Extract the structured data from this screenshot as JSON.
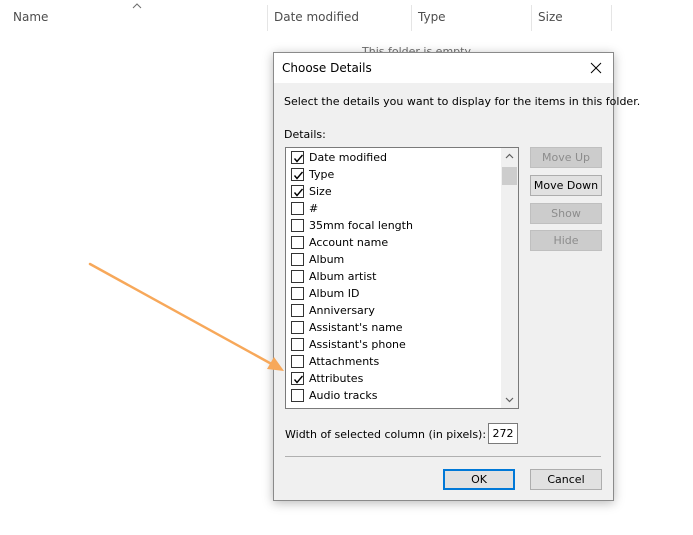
{
  "explorer": {
    "columns": [
      "Name",
      "Date modified",
      "Type",
      "Size"
    ],
    "empty_message": "This folder is empty."
  },
  "dialog": {
    "title": "Choose Details",
    "instruction": "Select the details you want to display for the items in this folder.",
    "details_label": "Details:",
    "items": [
      {
        "label": "Date modified",
        "checked": true
      },
      {
        "label": "Type",
        "checked": true
      },
      {
        "label": "Size",
        "checked": true
      },
      {
        "label": "#",
        "checked": false
      },
      {
        "label": "35mm focal length",
        "checked": false
      },
      {
        "label": "Account name",
        "checked": false
      },
      {
        "label": "Album",
        "checked": false
      },
      {
        "label": "Album artist",
        "checked": false
      },
      {
        "label": "Album ID",
        "checked": false
      },
      {
        "label": "Anniversary",
        "checked": false
      },
      {
        "label": "Assistant's name",
        "checked": false
      },
      {
        "label": "Assistant's phone",
        "checked": false
      },
      {
        "label": "Attachments",
        "checked": false
      },
      {
        "label": "Attributes",
        "checked": true
      },
      {
        "label": "Audio tracks",
        "checked": false
      }
    ],
    "buttons": {
      "move_up": "Move Up",
      "move_down": "Move Down",
      "show": "Show",
      "hide": "Hide",
      "ok": "OK",
      "cancel": "Cancel"
    },
    "width_label": "Width of selected column (in pixels):",
    "width_value": "272"
  },
  "colors": {
    "accent": "#0078d7",
    "annotation_arrow": "#f7a85a"
  }
}
